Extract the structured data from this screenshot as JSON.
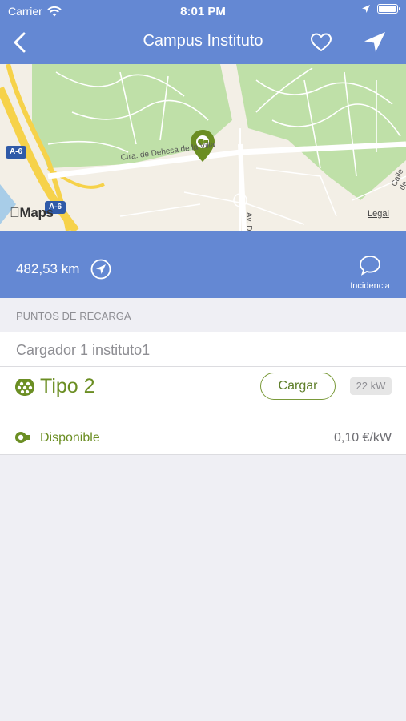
{
  "status_bar": {
    "carrier": "Carrier",
    "time": "8:01 PM"
  },
  "nav": {
    "title": "Campus Instituto",
    "back_icon": "chevron-left-icon",
    "favorite_icon": "heart-icon",
    "navigate_icon": "navigation-arrow-icon"
  },
  "map": {
    "road_label": "Ctra. de Dehesa de la Villa",
    "highway_labels": [
      "A-6",
      "A-6"
    ],
    "street_labels": [
      "Av. D",
      "Calle de"
    ],
    "maps_logo": "Maps",
    "legal": "Legal"
  },
  "info": {
    "distance": "482,53 km",
    "incidencia_label": "Incidencia"
  },
  "section": {
    "title": "PUNTOS DE RECARGA"
  },
  "charger": {
    "name": "Cargador 1 instituto1",
    "plug_type": "Tipo 2",
    "charge_button": "Cargar",
    "power": "22 kW",
    "status": "Disponible",
    "price": "0,10 €/kW"
  },
  "colors": {
    "header_blue": "#6488d3",
    "accent_green": "#6b8e23",
    "background": "#efeff4"
  }
}
